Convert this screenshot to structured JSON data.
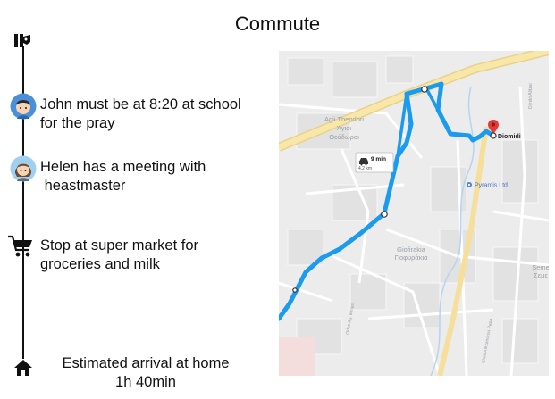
{
  "title": "Commute",
  "timeline": {
    "start_icon": "gift-icon",
    "items": [
      {
        "icon": "boy-avatar-icon",
        "line1": "John must be at 8:20 at school",
        "line2": "for the pray"
      },
      {
        "icon": "girl-avatar-icon",
        "line1": "Helen has a meeting with",
        "line2": " heastmaster"
      },
      {
        "icon": "shopping-cart-icon",
        "line1": "Stop at super market for",
        "line2": "groceries and milk"
      }
    ],
    "end": {
      "icon": "home-icon",
      "line1": "Estimated arrival at home",
      "line2": "1h 40min"
    }
  },
  "map": {
    "route_info": {
      "time": "9 min",
      "distance": "4.2 km",
      "icon": "car-icon"
    },
    "destination": "Diomidi",
    "place": "Pyramis Ltd",
    "area_labels": {
      "agioi_1": "Agii Theodori",
      "agioi_2": "Άγιοι",
      "agioi_3": "Θεόδωροι",
      "giofirakia_1": "Giofirakia",
      "giofirakia_2": "Γιοφυράκια",
      "semi_1": "Seme",
      "semi_2": "Σεμε",
      "street_1": "Odos Ag. Minas",
      "street_2": "Dimitri Alitzai",
      "street_3": "Ekati Alexandrou Papa"
    },
    "colors": {
      "route": "#1a9bf0",
      "highway": "#f5df9a",
      "pin": "#e53935",
      "background": "#ececec"
    }
  }
}
